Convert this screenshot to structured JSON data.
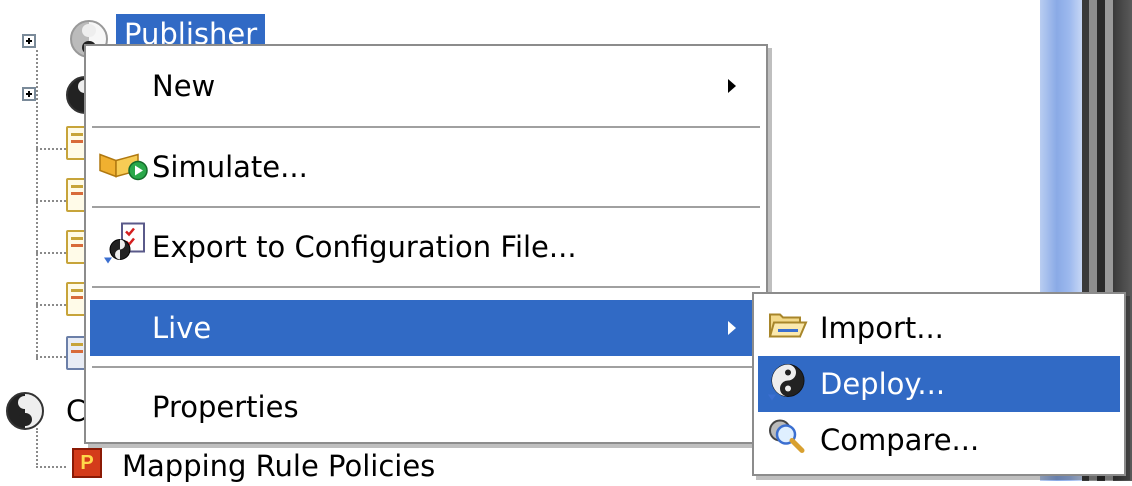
{
  "tree": {
    "items": [
      {
        "label": "Publisher"
      },
      {
        "label": "C"
      },
      {
        "label": "Mapping Rule Policies"
      }
    ]
  },
  "context_menu": {
    "items": [
      {
        "label": "New",
        "has_submenu": true
      },
      {
        "label": "Simulate...",
        "icon": "simulate-icon"
      },
      {
        "label": "Export to Configuration File...",
        "icon": "export-icon"
      },
      {
        "label": "Live",
        "has_submenu": true,
        "highlighted": true
      },
      {
        "label": "Properties"
      }
    ]
  },
  "submenu": {
    "items": [
      {
        "label": "Import...",
        "icon": "folder-open-icon"
      },
      {
        "label": "Deploy...",
        "icon": "deploy-icon",
        "highlighted": true
      },
      {
        "label": "Compare...",
        "icon": "compare-icon"
      }
    ]
  },
  "colors": {
    "highlight": "#316ac5",
    "menu_bg": "#ffffff",
    "menu_border": "#8c8c8c"
  }
}
